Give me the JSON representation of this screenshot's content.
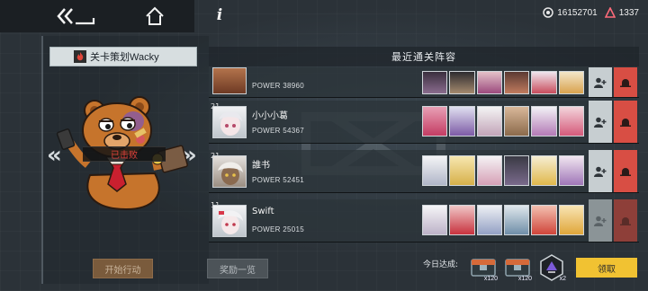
{
  "topbar": {
    "currency_amount": "16152701",
    "gem_amount": "1337"
  },
  "left": {
    "planner_label": "关卡策划Wacky",
    "defeated_label": "已击败",
    "start_button": "开始行动"
  },
  "list": {
    "header": "最近通关阵容",
    "rows": [
      {
        "level": "",
        "name": "",
        "power": "POWER 38960"
      },
      {
        "level": "21",
        "name": "小小小葛",
        "power": "POWER 54367"
      },
      {
        "level": "21",
        "name": "誰书",
        "power": "POWER 52451"
      },
      {
        "level": "11",
        "name": "Swift",
        "power": "POWER 25015"
      }
    ]
  },
  "bottom": {
    "rewards_button": "奖励一览",
    "daily_label": "今日达成:",
    "reward1_count": "x120",
    "reward2_count": "x120",
    "reward3_count": "x2",
    "claim_button": "领取"
  },
  "colors": {
    "accent_yellow": "#f1c232",
    "report_red": "#d84e44",
    "add_grey": "#c7ced1"
  }
}
